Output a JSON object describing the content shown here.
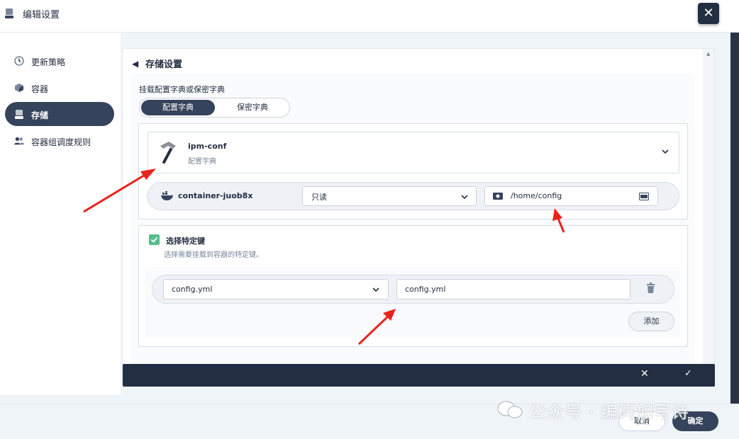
{
  "header": {
    "title": "编辑设置",
    "close_label": "✕"
  },
  "sidebar": {
    "items": [
      {
        "label": "更新策略",
        "icon": "clock-icon"
      },
      {
        "label": "容器",
        "icon": "cube-icon"
      },
      {
        "label": "存储",
        "icon": "drive-icon",
        "active": true
      },
      {
        "label": "容器组调度规则",
        "icon": "users-icon"
      }
    ]
  },
  "main": {
    "section_title": "存储设置",
    "mount_label": "挂载配置字典或保密字典",
    "tabs": [
      "配置字典",
      "保密字典"
    ],
    "item": {
      "name": "ipm-conf",
      "type": "配置字典"
    },
    "container": {
      "name": "container-juob8x",
      "access_mode": "只读",
      "mount_path": "/home/config"
    },
    "specific_keys": {
      "title": "选择特定键",
      "description": "选择需要挂载到容器的特定键。",
      "key": "config.yml",
      "path": "config.yml",
      "add_label": "添加"
    }
  },
  "footer": {
    "cancel_label": "取消",
    "ok_label": "确定"
  },
  "watermark": "公众号 · 编码如写诗",
  "colors": {
    "dark": "#242e42",
    "accent": "#36435c",
    "green": "#55bc8a",
    "arrow": "#e8231c"
  }
}
